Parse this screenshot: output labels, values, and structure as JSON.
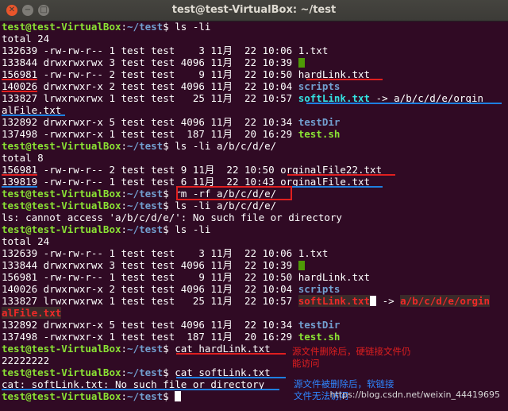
{
  "window": {
    "title": "test@test-VirtualBox: ~/test",
    "close_glyph": "✕",
    "minimize_glyph": "−",
    "maximize_glyph": "□",
    "icons": {
      "close": "close-icon",
      "minimize": "minimize-icon",
      "maximize": "maximize-icon"
    }
  },
  "terminal": {
    "prompt_user": "test@test-VirtualBox",
    "prompt_sep": ":",
    "prompt_dir": "~/test",
    "prompt_end": "$",
    "lines": {
      "l01_cmd": " ls -li",
      "l02": "total 24",
      "l03_pre": "132639 -rw-rw-r-- 1 test test    3 11月  22 10:06 ",
      "l03_name": "1.txt",
      "l04_pre": "133844 drwxrwxrwx 3 test test 4096 11月  22 10:39 ",
      "l05_pre": "156981 -rw-rw-r-- 2 test test    9 11月  22 10:50 ",
      "l05_name": "hardLink.txt",
      "l06_pre": "140026 drwxrwxr-x 2 test test 4096 11月  22 10:04 ",
      "l06_name": "scripts",
      "l07_pre": "133827 lrwxrwxrwx 1 test test   25 11月  22 10:57 ",
      "l07_name": "softLink.txt",
      "l07_arrow": " -> a/b/c/d/e/orgin",
      "l08": "alFile.txt",
      "l09_pre": "132892 drwxrwxr-x 5 test test 4096 11月  22 10:34 ",
      "l09_name": "testDir",
      "l10_pre": "137498 -rwxrwxr-x 1 test test  187 11月  20 16:29 ",
      "l10_name": "test.sh",
      "l11_cmd": " ls -li a/b/c/d/e/",
      "l12": "total 8",
      "l13": "156981 -rw-rw-r-- 2 test test 9 11月  22 10:50 orginalFile22.txt",
      "l14": "139819 -rw-rw-r-- 1 test test 6 11月  22 10:43 orginalFile.txt",
      "l15_cmd": " rm -rf a/b/c/d/e/",
      "l16_cmd": " ls -li a/b/c/d/e/",
      "l17": "ls: cannot access 'a/b/c/d/e/': No such file or directory",
      "l18_cmd": " ls -li",
      "l19": "total 24",
      "l20_pre": "132639 -rw-rw-r-- 1 test test    3 11月  22 10:06 ",
      "l20_name": "1.txt",
      "l21_pre": "133844 drwxrwxrwx 3 test test 4096 11月  22 10:39 ",
      "l22_pre": "156981 -rw-rw-r-- 1 test test    9 11月  22 10:50 ",
      "l22_name": "hardLink.txt",
      "l23_pre": "140026 drwxrwxr-x 2 test test 4096 11月  22 10:04 ",
      "l23_name": "scripts",
      "l24_pre": "133827 lrwxrwxrwx 1 test test   25 11月  22 10:57 ",
      "l24_name": "softLink.txt",
      "l24_arrow": " -> ",
      "l24_target": "a/b/c/d/e/orgin",
      "l25": "alFile.txt",
      "l26_pre": "132892 drwxrwxr-x 5 test test 4096 11月  22 10:34 ",
      "l26_name": "testDir",
      "l27_pre": "137498 -rwxrwxr-x 1 test test  187 11月  20 16:29 ",
      "l27_name": "test.sh",
      "l28_cmd": " cat hardLink.txt",
      "l29": "22222222",
      "l30_cmd": " cat softLink.txt",
      "l31": "cat: softLink.txt: No such file or directory",
      "l32_cmd": " "
    }
  },
  "annotations": {
    "note_hard": [
      "源文件删除后，硬链接文件仍",
      "能访问"
    ],
    "note_soft": [
      "源文件被删除后，软链接",
      "文件无法访问"
    ]
  },
  "watermark": "https://blog.csdn.net/weixin_44419695",
  "colors": {
    "background": "#300a24",
    "prompt": "#8ae234",
    "directory": "#729fcf",
    "symlink": "#34e2e2",
    "annotation_red": "#e01f1f",
    "annotation_blue": "#1e7fe0"
  }
}
